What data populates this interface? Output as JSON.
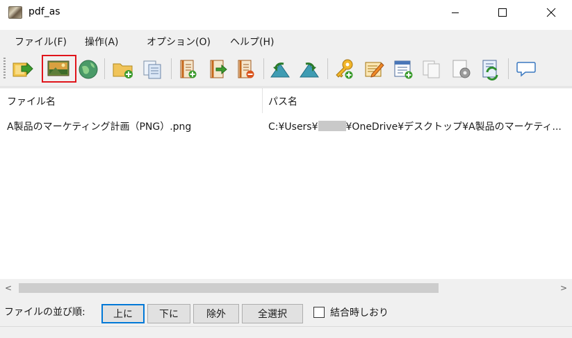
{
  "window": {
    "title": "pdf_as",
    "controls": {
      "minimize_icon": "minimize-icon",
      "maximize_icon": "maximize-icon",
      "close_icon": "close-icon"
    }
  },
  "menu": {
    "items": [
      {
        "label": "ファイル(F)"
      },
      {
        "label": "操作(A)"
      },
      {
        "label": "オプション(O)"
      },
      {
        "label": "ヘルプ(H)"
      }
    ]
  },
  "toolbar": {
    "buttons": [
      {
        "icon": "export-arrow-icon"
      },
      {
        "icon": "image-icon",
        "highlighted": true
      },
      {
        "icon": "globe-icon"
      },
      {
        "icon": "folder-add-icon"
      },
      {
        "icon": "copy-pages-icon"
      },
      {
        "icon": "page-insert-icon"
      },
      {
        "icon": "page-move-icon"
      },
      {
        "icon": "page-remove-icon"
      },
      {
        "icon": "rotate-left-icon"
      },
      {
        "icon": "rotate-right-icon"
      },
      {
        "icon": "key-icon"
      },
      {
        "icon": "edit-icon"
      },
      {
        "icon": "form-add-icon"
      },
      {
        "icon": "duplicate-icon"
      },
      {
        "icon": "settings-page-icon"
      },
      {
        "icon": "refresh-page-icon"
      },
      {
        "icon": "comment-icon"
      }
    ]
  },
  "file_list": {
    "columns": [
      {
        "label": "ファイル名"
      },
      {
        "label": "パス名"
      }
    ],
    "rows": [
      {
        "filename": "A製品のマーケティング計画（PNG）.png",
        "path_prefix": "C:¥Users¥",
        "path_suffix": "¥OneDrive¥デスクトップ¥A製品のマーケティ..."
      }
    ]
  },
  "scrollbar": {
    "left_arrow": "<",
    "right_arrow": ">"
  },
  "order_controls": {
    "label": "ファイルの並び順:",
    "up_label": "上に",
    "down_label": "下に",
    "remove_label": "除外",
    "select_all_label": "全選択",
    "bookmark_label": "結合時しおり",
    "bookmark_checked": false
  }
}
